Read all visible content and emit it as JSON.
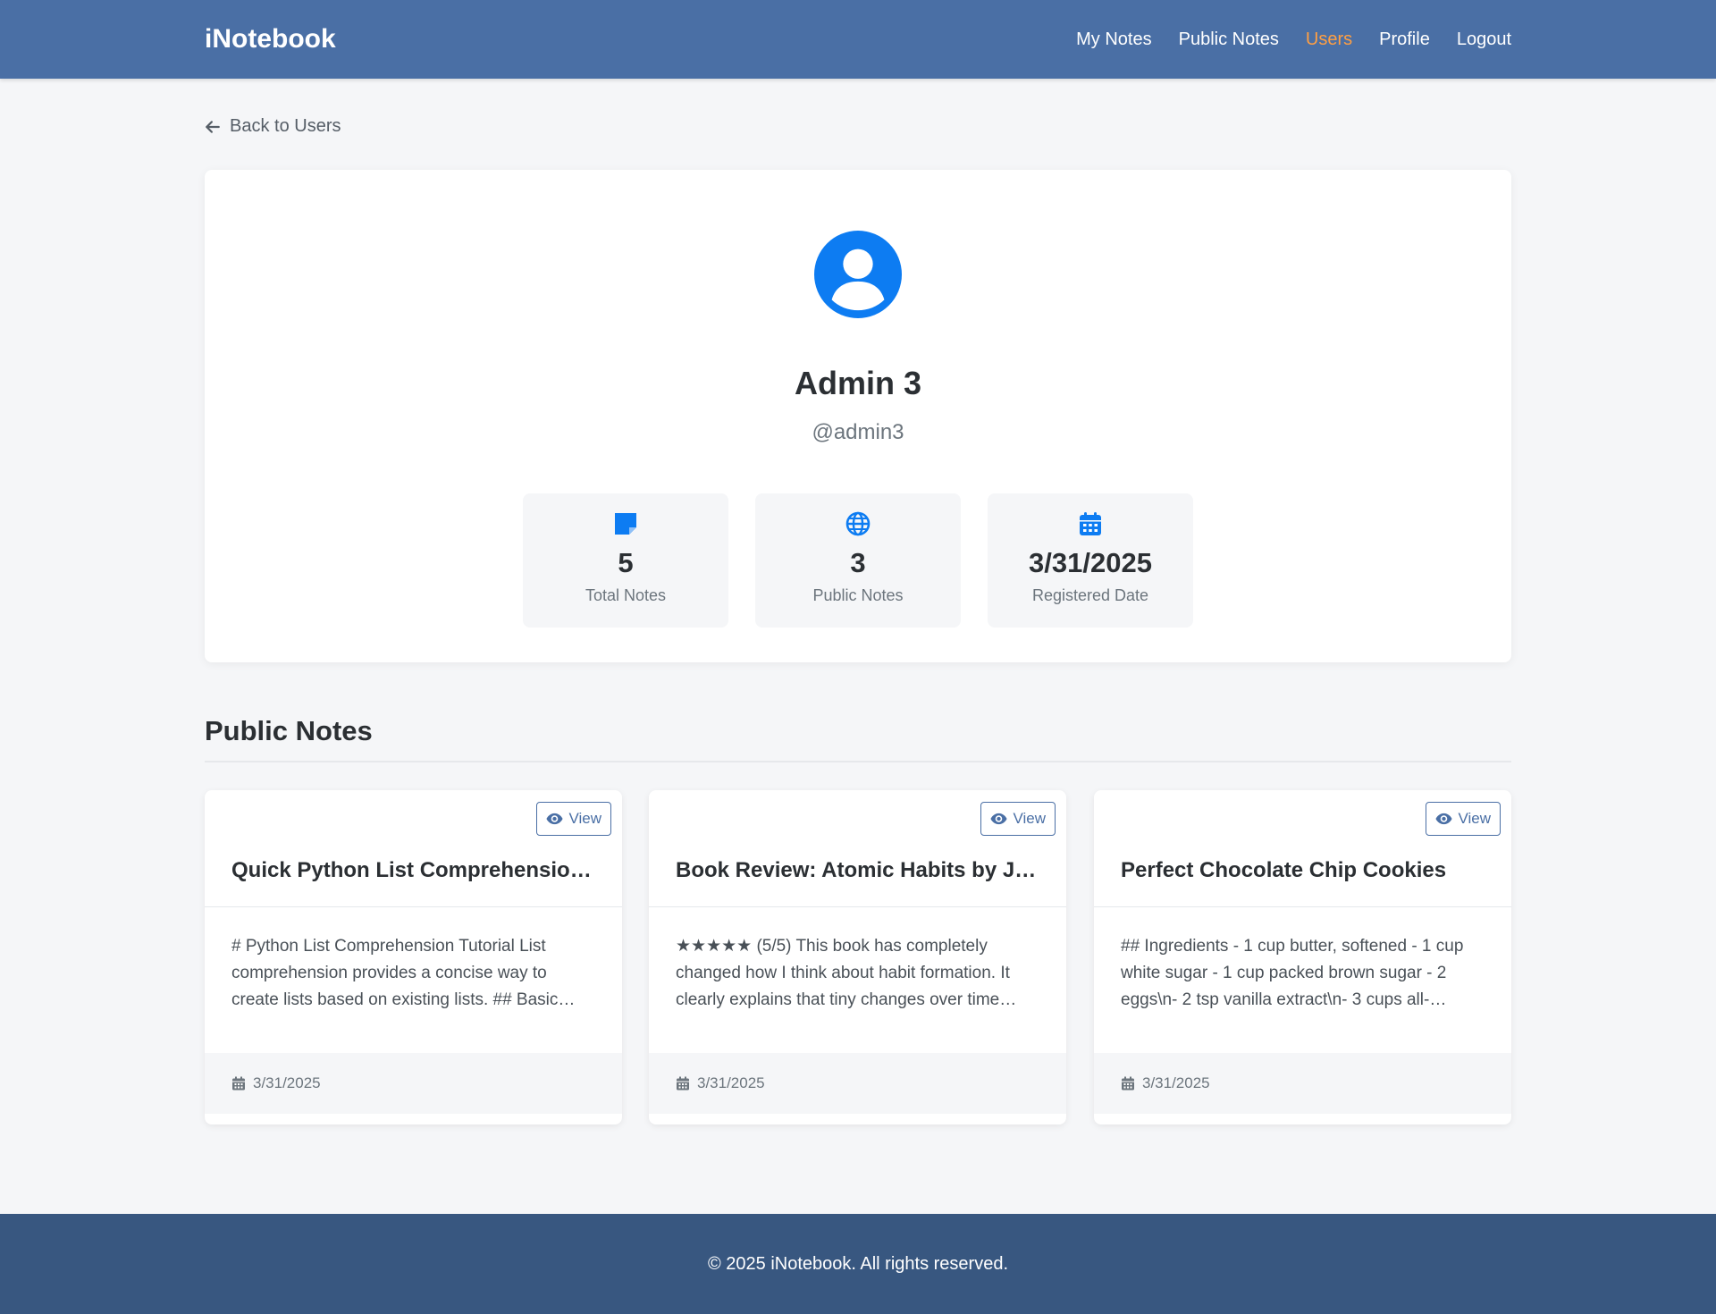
{
  "nav": {
    "brand": "iNotebook",
    "links": [
      {
        "label": "My Notes"
      },
      {
        "label": "Public Notes"
      },
      {
        "label": "Users"
      },
      {
        "label": "Profile"
      },
      {
        "label": "Logout"
      }
    ],
    "active_link": "Users",
    "active_color": "#ff9f43"
  },
  "back_link": {
    "label": "Back to Users",
    "icon": "arrow-left-icon"
  },
  "profile": {
    "name": "Admin 3",
    "username": "@admin3",
    "avatar_icon": "user-circle-icon",
    "accent_color": "#0d7cf2",
    "stats": [
      {
        "icon": "sticky-note-icon",
        "value": "5",
        "label": "Total Notes"
      },
      {
        "icon": "globe-icon",
        "value": "3",
        "label": "Public Notes"
      },
      {
        "icon": "calendar-icon",
        "value": "3/31/2025",
        "label": "Registered Date"
      }
    ]
  },
  "public_notes": {
    "title": "Public Notes",
    "view_label": "View",
    "items": [
      {
        "title": "Quick Python List Comprehension Tutorial",
        "body": "# Python List Comprehension Tutorial List comprehension provides a concise way to create lists based on existing lists. ## Basic…",
        "date": "3/31/2025"
      },
      {
        "title": "Book Review: Atomic Habits by James Clear",
        "body": "★★★★★ (5/5) This book has completely changed how I think about habit formation. It clearly explains that tiny changes over time…",
        "date": "3/31/2025"
      },
      {
        "title": "Perfect Chocolate Chip Cookies",
        "body": "## Ingredients - 1 cup butter, softened - 1 cup white sugar - 1 cup packed brown sugar - 2 eggs\\n- 2 tsp vanilla extract\\n- 3 cups all-…",
        "date": "3/31/2025"
      }
    ]
  },
  "footer": {
    "text": "© 2025 iNotebook. All rights reserved."
  },
  "colors": {
    "navbar": "#4a6fa5",
    "footer": "#385780",
    "background": "#f5f6f8"
  }
}
